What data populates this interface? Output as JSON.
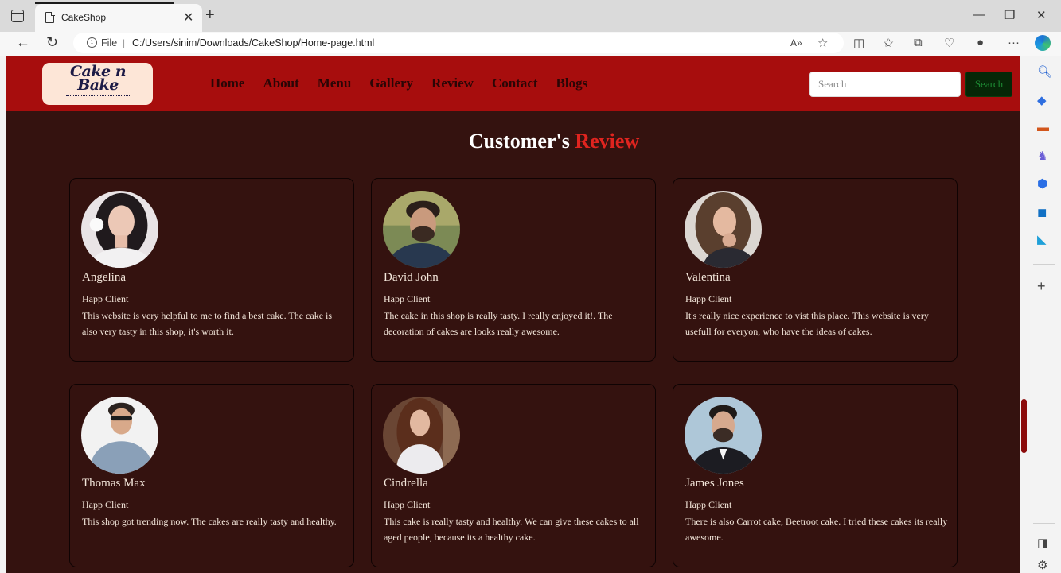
{
  "browser": {
    "tab_title": "CakeShop",
    "address_prefix": "File",
    "url": "C:/Users/sinim/Downloads/CakeShop/Home-page.html",
    "icons": [
      "back-icon",
      "refresh-icon",
      "info-icon",
      "read-aloud-icon",
      "favorite-star-icon",
      "split-screen-icon",
      "favorites-icon",
      "collections-icon",
      "browser-essentials-icon",
      "profile-icon",
      "more-icon",
      "copilot-icon"
    ]
  },
  "site": {
    "logo_text": "Cake n Bake",
    "nav": [
      "Home",
      "About",
      "Menu",
      "Gallery",
      "Review",
      "Contact",
      "Blogs"
    ],
    "search_placeholder": "Search",
    "search_button": "Search",
    "title_main": "Customer's",
    "title_accent": "Review",
    "colors": {
      "header": "#a70d0d",
      "background": "#34120f",
      "accent": "#e0241f",
      "search_button": "#062707"
    }
  },
  "reviews": [
    {
      "name": "Angelina",
      "role": "Happ Client",
      "text": "This website is very helpful to me to find a best cake. The cake is also very tasty in this shop, it's worth it."
    },
    {
      "name": "David John",
      "role": "Happ Client",
      "text": "The cake in this shop is really tasty. I really enjoyed it!. The decoration of cakes are looks really awesome."
    },
    {
      "name": "Valentina",
      "role": "Happ Client",
      "text": "It's really nice experience to vist this place. This website is very usefull for everyon, who have the ideas of cakes."
    },
    {
      "name": "Thomas Max",
      "role": "Happ Client",
      "text": "This shop got trending now. The cakes are really tasty and healthy."
    },
    {
      "name": "Cindrella",
      "role": "Happ Client",
      "text": "This cake is really tasty and healthy. We can give these cakes to all aged people, because its a healthy cake."
    },
    {
      "name": "James Jones",
      "role": "Happ Client",
      "text": "There is also Carrot cake, Beetroot cake. I tried these cakes its really awesome."
    }
  ]
}
